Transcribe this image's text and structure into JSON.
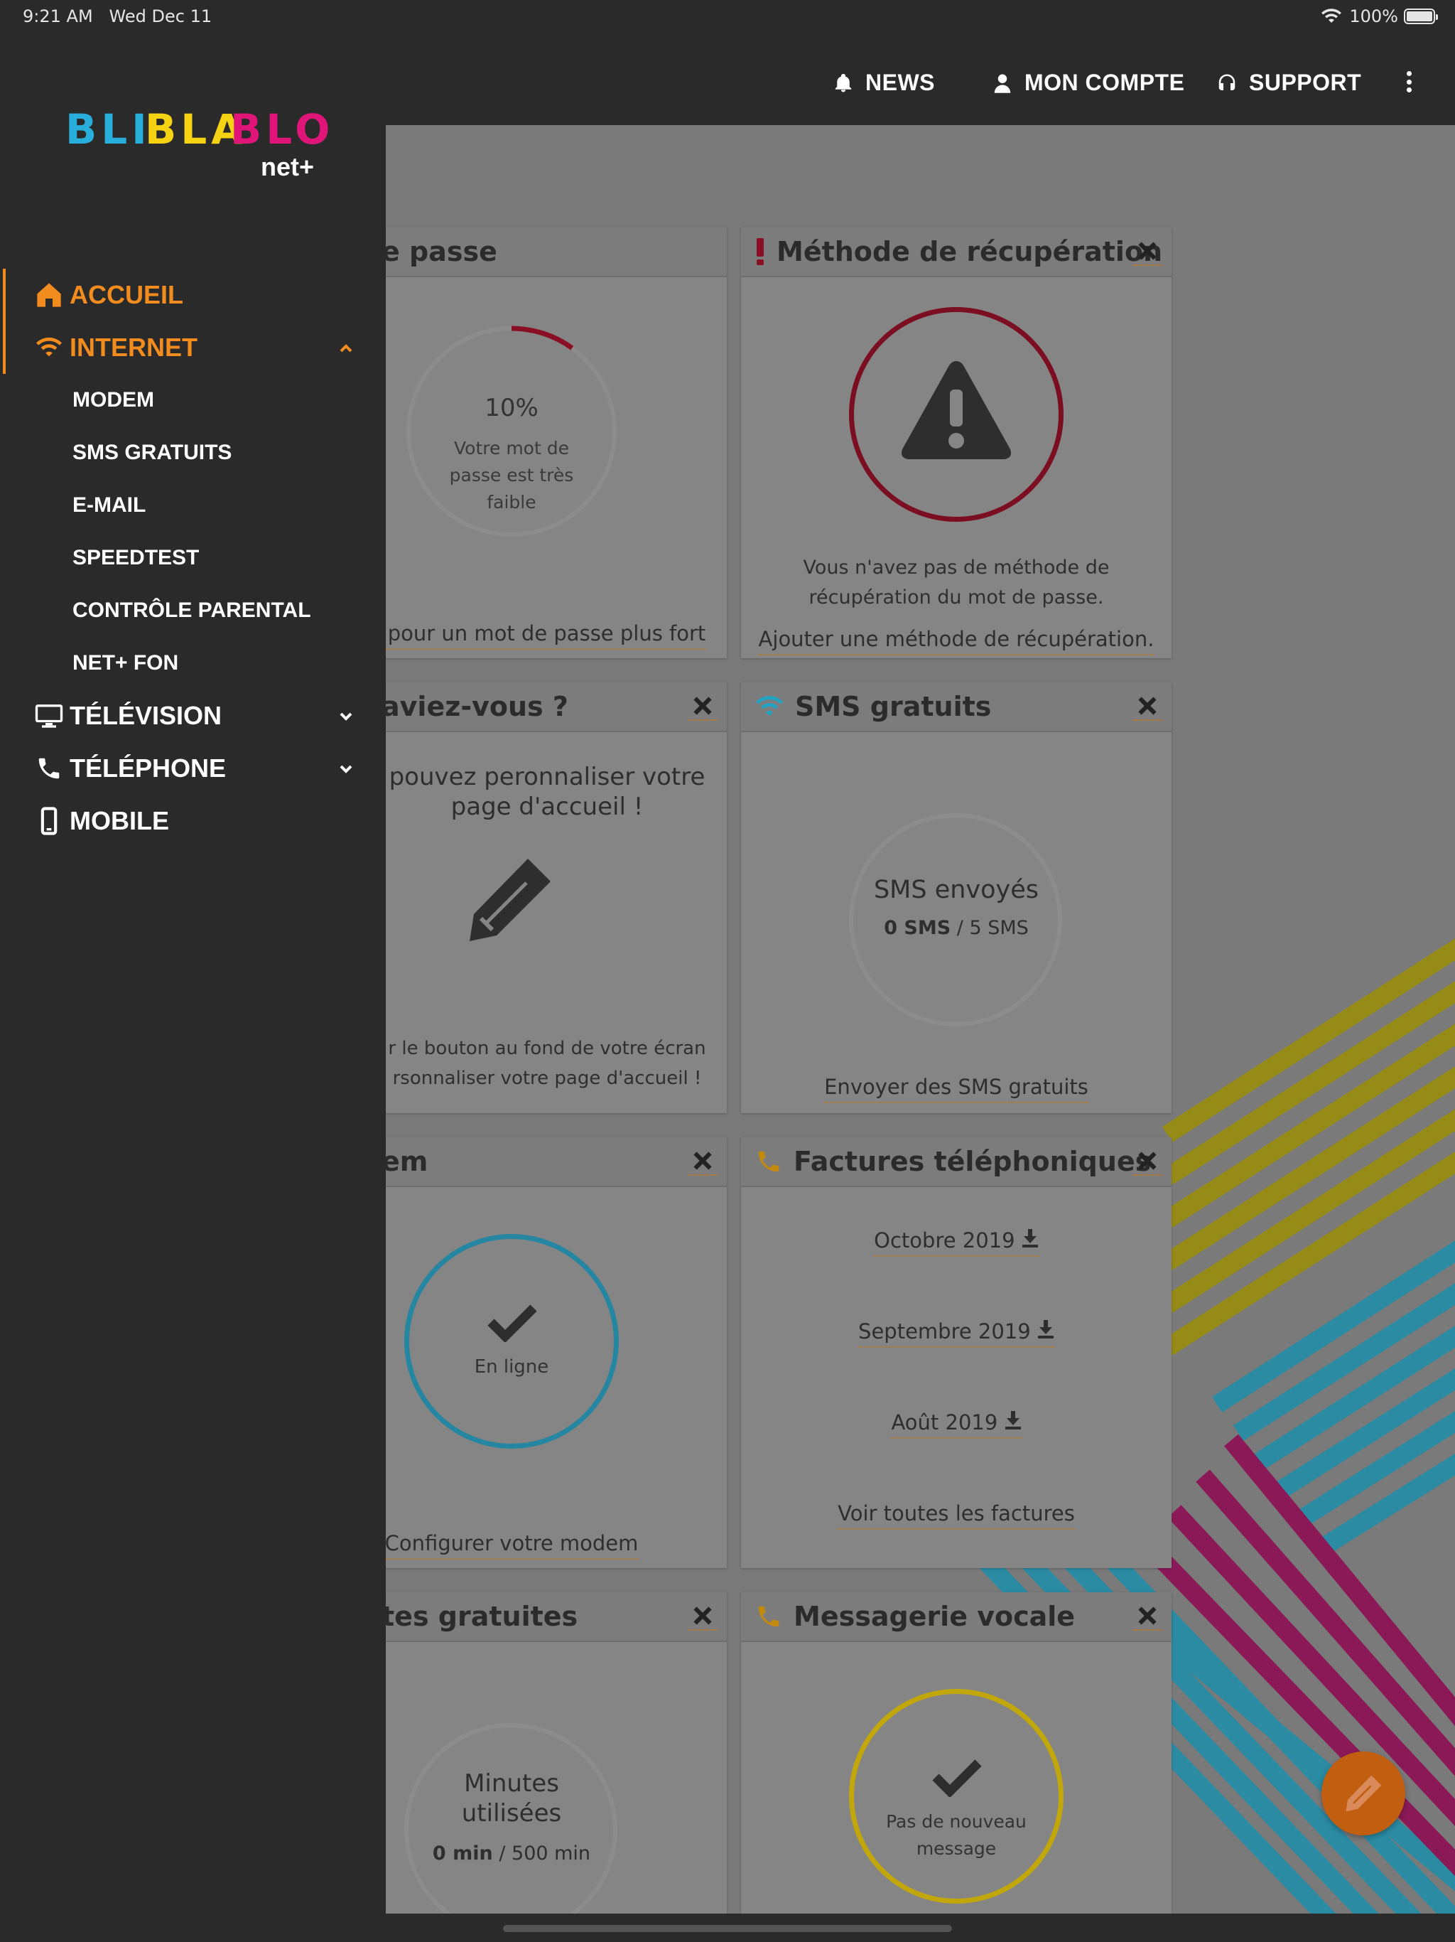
{
  "status_bar": {
    "time": "9:21 AM",
    "date": "Wed Dec 11",
    "battery": "100%"
  },
  "top_nav": {
    "news": "NEWS",
    "account": "MON COMPTE",
    "support": "SUPPORT"
  },
  "logo": {
    "words": [
      "BLI",
      "BLA",
      "BLO"
    ],
    "sub": "net+",
    "colors": [
      "#27aedb",
      "#f5d313",
      "#e0157a"
    ]
  },
  "sidebar": {
    "items": [
      {
        "label": "ACCUEIL",
        "icon": "home-icon",
        "active": true
      },
      {
        "label": "INTERNET",
        "icon": "wifi-icon",
        "active": true,
        "expanded": true
      },
      {
        "label": "TÉLÉVISION",
        "icon": "tv-icon"
      },
      {
        "label": "TÉLÉPHONE",
        "icon": "phone-icon"
      },
      {
        "label": "MOBILE",
        "icon": "mobile-icon"
      }
    ],
    "internet_submenu": [
      "MODEM",
      "SMS GRATUITS",
      "E-MAIL",
      "SPEEDTEST",
      "CONTRÔLE PARENTAL",
      "NET+ FON"
    ]
  },
  "cards": {
    "password": {
      "title": "e passe",
      "percent": "10%",
      "percent_value": 0.1,
      "status": [
        "Votre mot de",
        "passe est très",
        "faible"
      ],
      "link": "er pour un mot de passe plus fort"
    },
    "recovery": {
      "title": "Méthode de récupération",
      "text": [
        "Vous n'avez pas de méthode de",
        "récupération du mot de passe."
      ],
      "link": "Ajouter une méthode de récupération."
    },
    "tip": {
      "title": "aviez-vous ?",
      "headline": [
        "pouvez peronnaliser votre",
        "page d'accueil !"
      ],
      "text": [
        "r le bouton au fond de votre écran",
        "rsonnaliser votre page d'accueil !"
      ]
    },
    "sms": {
      "title": "SMS gratuits",
      "label": "SMS envoyés",
      "used": "0 SMS",
      "sep": "/",
      "total": "5 SMS",
      "link": "Envoyer des SMS gratuits"
    },
    "modem": {
      "title": "em",
      "status": "En ligne",
      "link": "Configurer votre modem"
    },
    "invoices": {
      "title": "Factures téléphoniques",
      "items": [
        "Octobre 2019",
        "Septembre 2019",
        "Août 2019"
      ],
      "link": "Voir toutes les factures"
    },
    "minutes": {
      "title": "tes gratuites",
      "label": [
        "Minutes",
        "utilisées"
      ],
      "used": "0 min",
      "sep": "/",
      "total": "500 min"
    },
    "voicemail": {
      "title": "Messagerie vocale",
      "status": [
        "Pas de nouveau",
        "message"
      ]
    }
  },
  "colors": {
    "accent": "#f28c1e",
    "danger": "#8b0f24",
    "teal": "#23a3c4",
    "yellow": "#d3b80a",
    "magenta": "#c2136b"
  }
}
